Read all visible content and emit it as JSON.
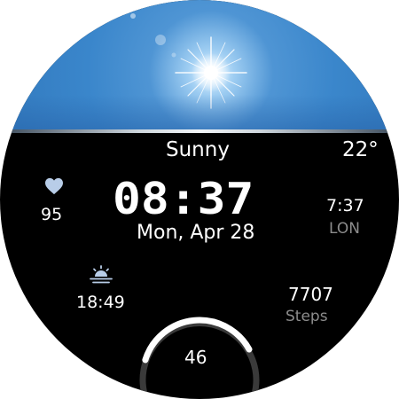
{
  "weather": {
    "condition": "Sunny",
    "temperature": "22°",
    "icon": "sun-photo"
  },
  "clock": {
    "time": "08:37",
    "date": "Mon, Apr 28"
  },
  "heart_rate": {
    "icon": "heart-icon",
    "value": "95"
  },
  "world_clock": {
    "time": "7:37",
    "city": "LON"
  },
  "sunset": {
    "icon": "sunset-icon",
    "time": "18:49"
  },
  "steps": {
    "value": "7707",
    "label": "Steps"
  },
  "gauge": {
    "value": "46",
    "progress": 0.46
  },
  "colors": {
    "background": "#000000",
    "text": "#ffffff",
    "muted_text": "#8c8c8c",
    "accent_icon": "#b8cde8",
    "sky": "#3a86cb"
  }
}
